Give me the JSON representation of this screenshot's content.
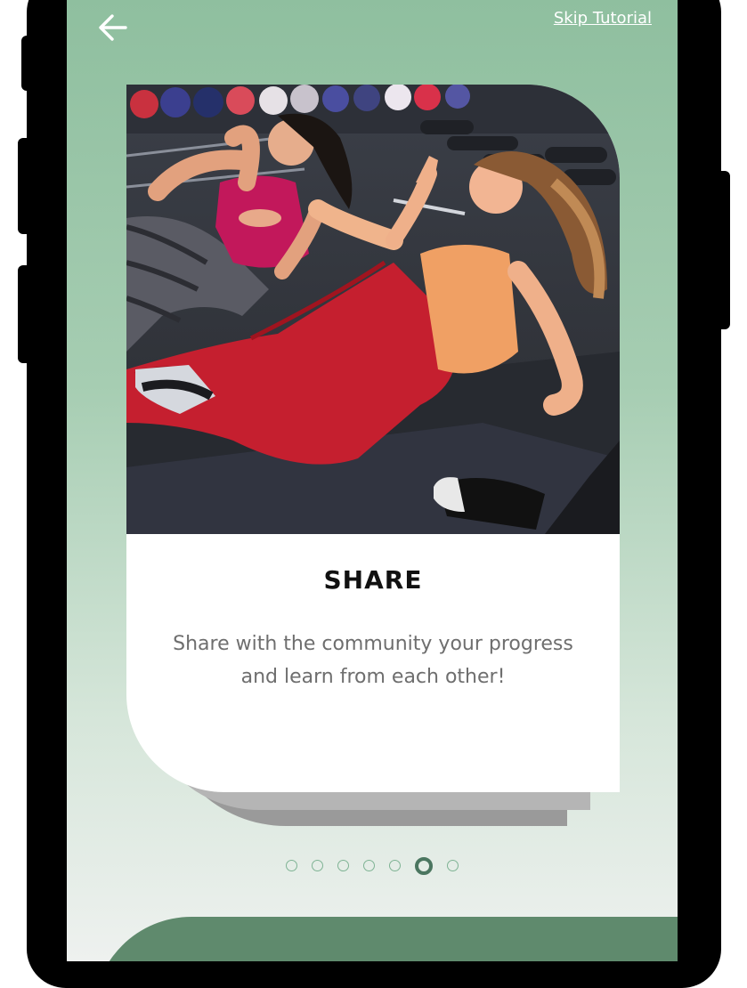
{
  "header": {
    "back_icon": "arrow-left-icon",
    "skip_label": "Skip Tutorial"
  },
  "card": {
    "image": "women-doing-abs-workout-photo",
    "title": "SHARE",
    "description": "Share with the community your progress and learn from each other!"
  },
  "pagination": {
    "total": 7,
    "current": 6
  },
  "colors": {
    "gradient_top": "#8fbf9f",
    "gradient_bottom": "#eef1ef",
    "accent_dark": "#4b7660",
    "bottom_bar": "#5f8a6d"
  }
}
